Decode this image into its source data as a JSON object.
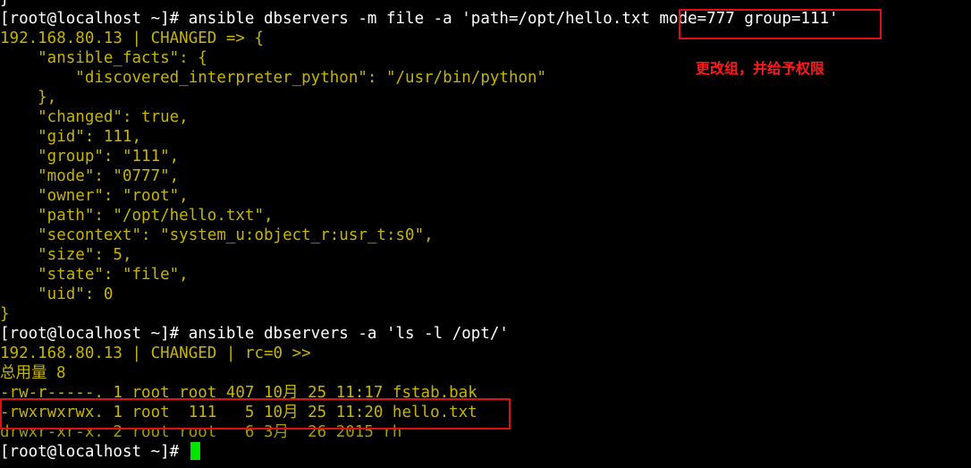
{
  "colors": {
    "background": "#000000",
    "command_text": "#ffffff",
    "output_text": "#c8b400",
    "highlight_border": "#e01010",
    "annotation_text": "#ff1a1a",
    "cursor": "#00e600"
  },
  "terminal": {
    "lines": [
      "}",
      "[root@localhost ~]# ansible dbservers -m file -a 'path=/opt/hello.txt mode=777 group=111'",
      "192.168.80.13 | CHANGED => {",
      "    \"ansible_facts\": {",
      "        \"discovered_interpreter_python\": \"/usr/bin/python\"",
      "    },",
      "    \"changed\": true,",
      "    \"gid\": 111,",
      "    \"group\": \"111\",",
      "    \"mode\": \"0777\",",
      "    \"owner\": \"root\",",
      "    \"path\": \"/opt/hello.txt\",",
      "    \"secontext\": \"system_u:object_r:usr_t:s0\",",
      "    \"size\": 5,",
      "    \"state\": \"file\",",
      "    \"uid\": 0",
      "}",
      "[root@localhost ~]# ansible dbservers -a 'ls -l /opt/'",
      "192.168.80.13 | CHANGED | rc=0 >>",
      "总用量 8",
      "-rw-r-----. 1 root root 407 10月 25 11:17 fstab.bak",
      "-rwxrwxrwx. 1 root  111   5 10月 25 11:20 hello.txt",
      "drwxr-xr-x. 2 root root   6 3月  26 2015 rh",
      "[root@localhost ~]# "
    ]
  },
  "annotation": {
    "text": "更改组，并给予权限"
  }
}
